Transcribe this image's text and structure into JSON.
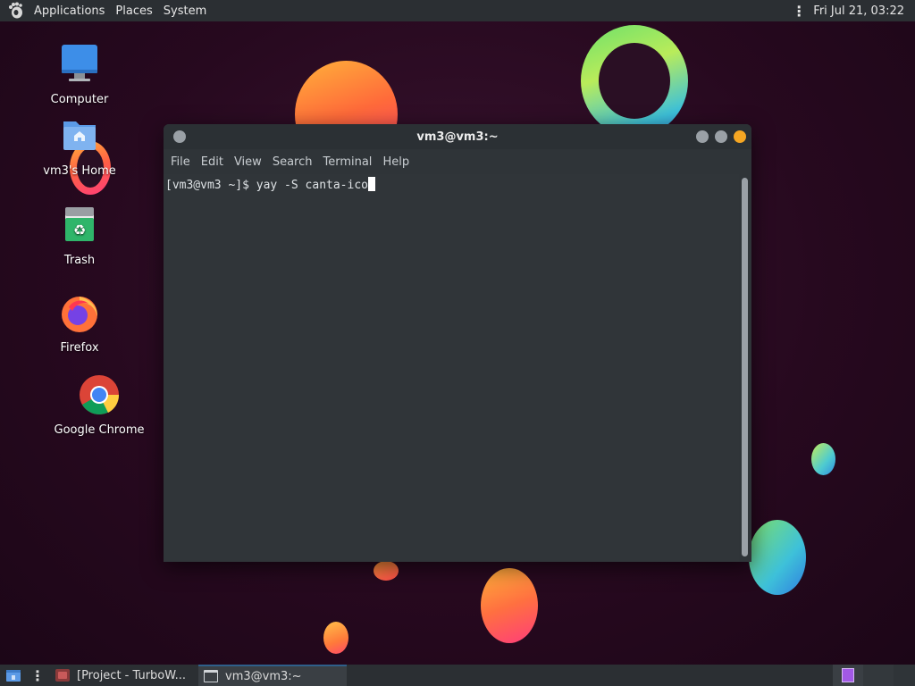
{
  "top_panel": {
    "applications": "Applications",
    "places": "Places",
    "system": "System",
    "clock": "Fri Jul 21, 03:22"
  },
  "desktop_icons": {
    "computer": "Computer",
    "home": "vm3's Home",
    "trash": "Trash",
    "firefox": "Firefox",
    "chrome": "Google Chrome"
  },
  "terminal": {
    "title": "vm3@vm3:~",
    "menu": [
      "File",
      "Edit",
      "View",
      "Search",
      "Terminal",
      "Help"
    ],
    "prompt": "[vm3@vm3 ~]$ ",
    "command": "yay -S canta-ico"
  },
  "taskbar": {
    "tasks": [
      {
        "label": "[Project - TurboW..."
      },
      {
        "label": "vm3@vm3:~"
      }
    ]
  },
  "colors": {
    "panel": "#2b2f33",
    "terminal_bg": "#303539",
    "close_button": "#f5a623",
    "workspace_active": "#a259e6"
  },
  "icons": {
    "panel_logo": "gnome-foot-icon",
    "show_desktop": "desktop-icon",
    "task_project": "app-window-icon",
    "task_terminal": "terminal-window-icon"
  }
}
